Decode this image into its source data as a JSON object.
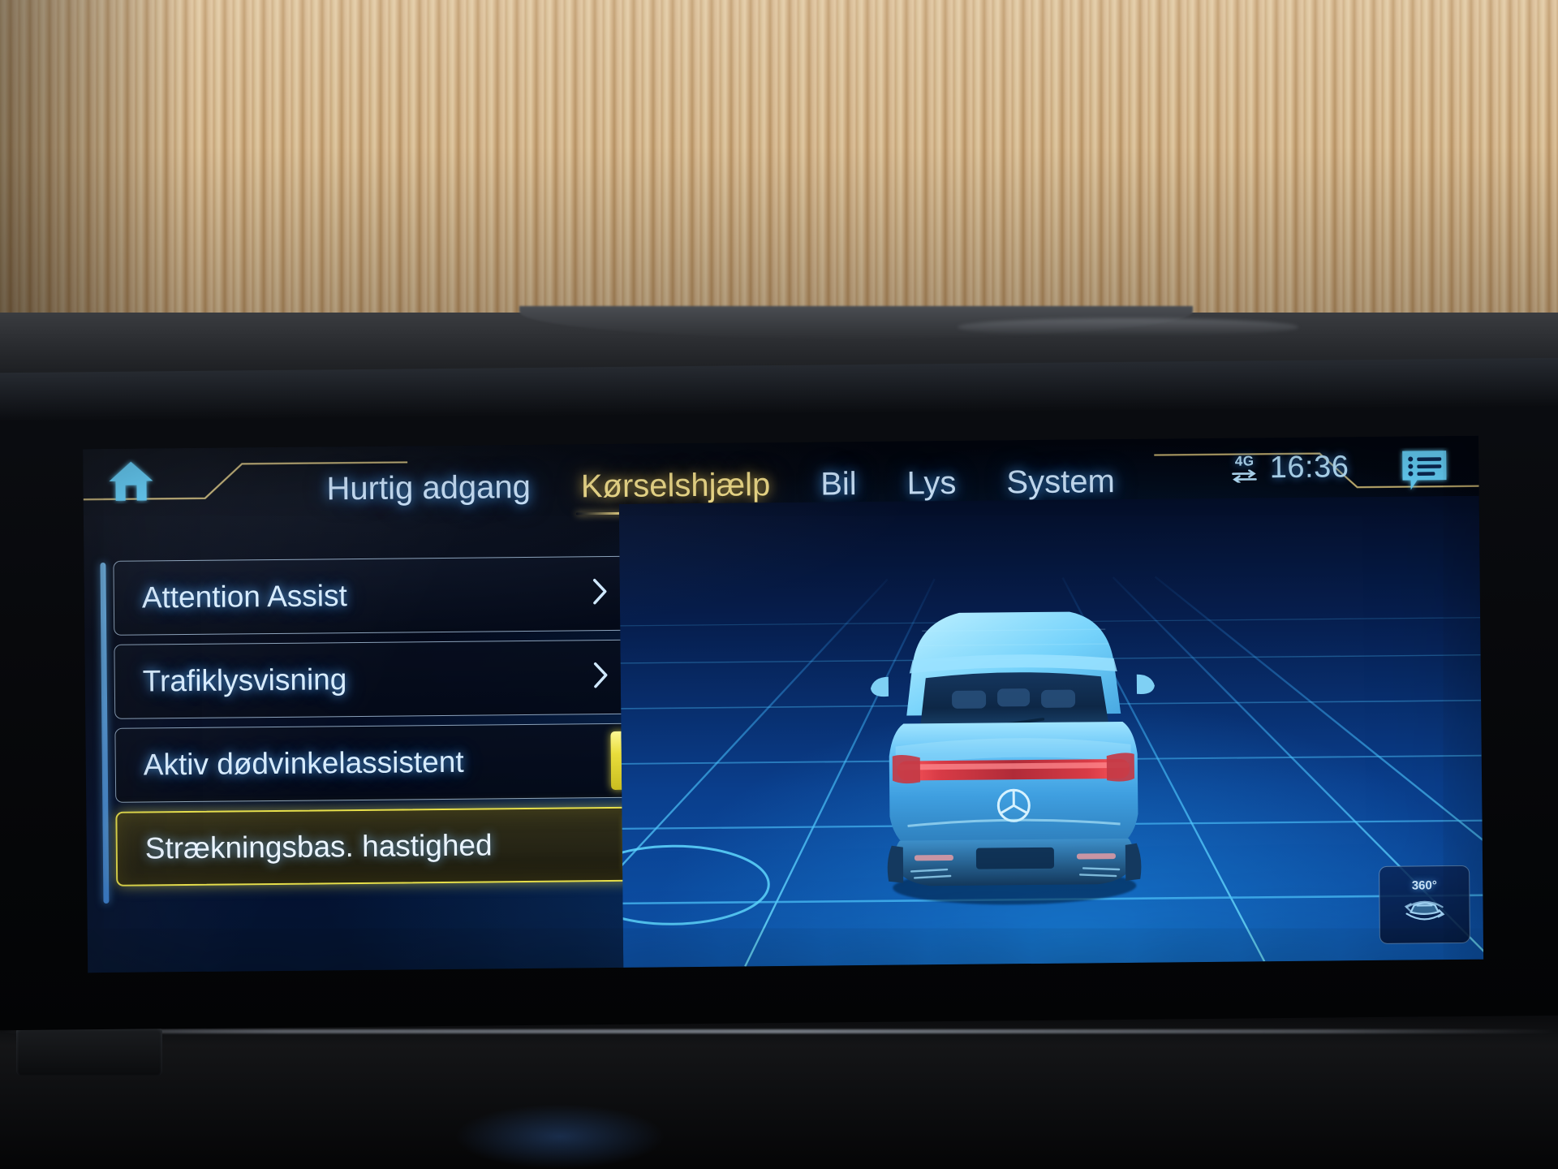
{
  "screen": {
    "brand_context": "mercedes-mbux-infotainment",
    "header": {
      "home_icon": "home-icon",
      "menu_icon": "list-bubble-icon",
      "status": {
        "network_label": "4G",
        "network_icon": "data-transfer-icon",
        "time": "16:36"
      }
    },
    "tabs": [
      {
        "label": "Hurtig adgang",
        "active": false
      },
      {
        "label": "Kørselshjælp",
        "active": true
      },
      {
        "label": "Bil",
        "active": false
      },
      {
        "label": "Lys",
        "active": false
      },
      {
        "label": "System",
        "active": false
      }
    ],
    "list": [
      {
        "label": "Attention Assist",
        "type": "submenu",
        "icon": "chevron-right-icon",
        "selected": false
      },
      {
        "label": "Trafiklysvisning",
        "type": "submenu",
        "icon": "chevron-right-icon",
        "selected": false
      },
      {
        "label": "Aktiv dødvinkelassistent",
        "type": "toggle",
        "icon": "toggle-indicator",
        "selected": false
      },
      {
        "label": "Strækningsbas. hastighed",
        "type": "toggle",
        "icon": "toggle-indicator",
        "selected": true
      }
    ],
    "visualization": {
      "subject": "vehicle-rear-view-3d",
      "camera_button": {
        "label": "360°",
        "icon": "surround-view-icon"
      }
    },
    "colors": {
      "accent_yellow": "#e8e04a",
      "tab_active": "#f5e08a",
      "text_blue": "#d7ecff",
      "grid_blue": "#35b6ff",
      "screen_bg": "#04102a"
    }
  }
}
